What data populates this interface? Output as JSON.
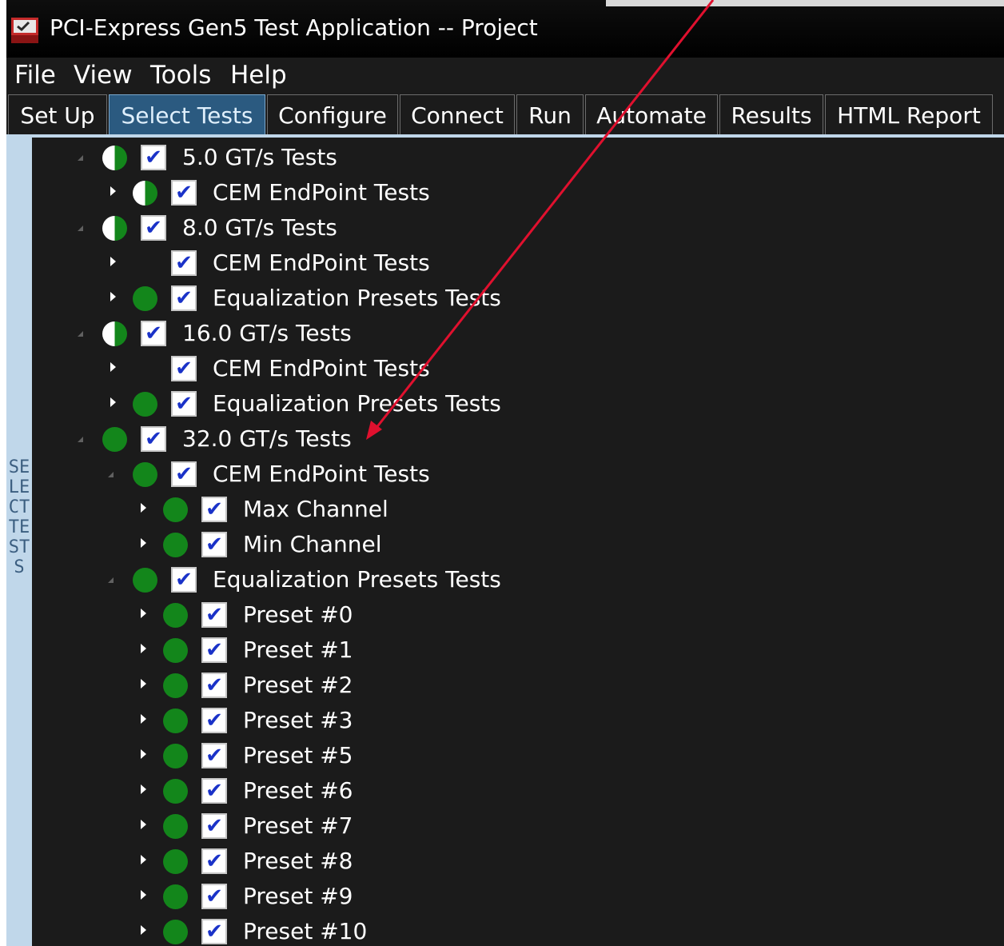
{
  "app": {
    "title": "PCI-Express Gen5 Test Application -- Project"
  },
  "menu": [
    "File",
    "View",
    "Tools",
    "Help"
  ],
  "tabs": [
    "Set Up",
    "Select Tests",
    "Configure",
    "Connect",
    "Run",
    "Automate",
    "Results",
    "HTML Report"
  ],
  "active_tab": "Select Tests",
  "side_panel_label": "SELECT TESTS",
  "tree": [
    {
      "label": "5.0 GT/s Tests",
      "expander": "open",
      "status": "half",
      "checked": true
    },
    {
      "label": "CEM EndPoint Tests",
      "expander": "closed",
      "status": "half",
      "checked": true
    },
    {
      "label": "8.0 GT/s Tests",
      "expander": "open",
      "status": "half",
      "checked": true
    },
    {
      "label": "CEM EndPoint Tests",
      "expander": "closed",
      "status": "none",
      "checked": true
    },
    {
      "label": "Equalization Presets Tests",
      "expander": "closed",
      "status": "pass",
      "checked": true
    },
    {
      "label": "16.0 GT/s Tests",
      "expander": "open",
      "status": "half",
      "checked": true
    },
    {
      "label": "CEM EndPoint Tests",
      "expander": "closed",
      "status": "none",
      "checked": true
    },
    {
      "label": "Equalization Presets Tests",
      "expander": "closed",
      "status": "pass",
      "checked": true
    },
    {
      "label": "32.0 GT/s Tests",
      "expander": "open",
      "status": "pass",
      "checked": true
    },
    {
      "label": "CEM EndPoint Tests",
      "expander": "open",
      "status": "pass",
      "checked": true
    },
    {
      "label": "Max Channel",
      "expander": "closed",
      "status": "pass",
      "checked": true
    },
    {
      "label": "Min Channel",
      "expander": "closed",
      "status": "pass",
      "checked": true
    },
    {
      "label": "Equalization Presets Tests",
      "expander": "open",
      "status": "pass",
      "checked": true
    },
    {
      "label": "Preset #0",
      "expander": "closed",
      "status": "pass",
      "checked": true
    },
    {
      "label": "Preset #1",
      "expander": "closed",
      "status": "pass",
      "checked": true
    },
    {
      "label": "Preset #2",
      "expander": "closed",
      "status": "pass",
      "checked": true
    },
    {
      "label": "Preset #3",
      "expander": "closed",
      "status": "pass",
      "checked": true
    },
    {
      "label": "Preset #5",
      "expander": "closed",
      "status": "pass",
      "checked": true
    },
    {
      "label": "Preset #6",
      "expander": "closed",
      "status": "pass",
      "checked": true
    },
    {
      "label": "Preset #7",
      "expander": "closed",
      "status": "pass",
      "checked": true
    },
    {
      "label": "Preset #8",
      "expander": "closed",
      "status": "pass",
      "checked": true
    },
    {
      "label": "Preset #9",
      "expander": "closed",
      "status": "pass",
      "checked": true
    },
    {
      "label": "Preset #10",
      "expander": "closed",
      "status": "pass",
      "checked": true
    }
  ],
  "colors": {
    "pass": "#13861b",
    "annotation_arrow": "#e0102e",
    "active_tab": "#2b5a80"
  }
}
